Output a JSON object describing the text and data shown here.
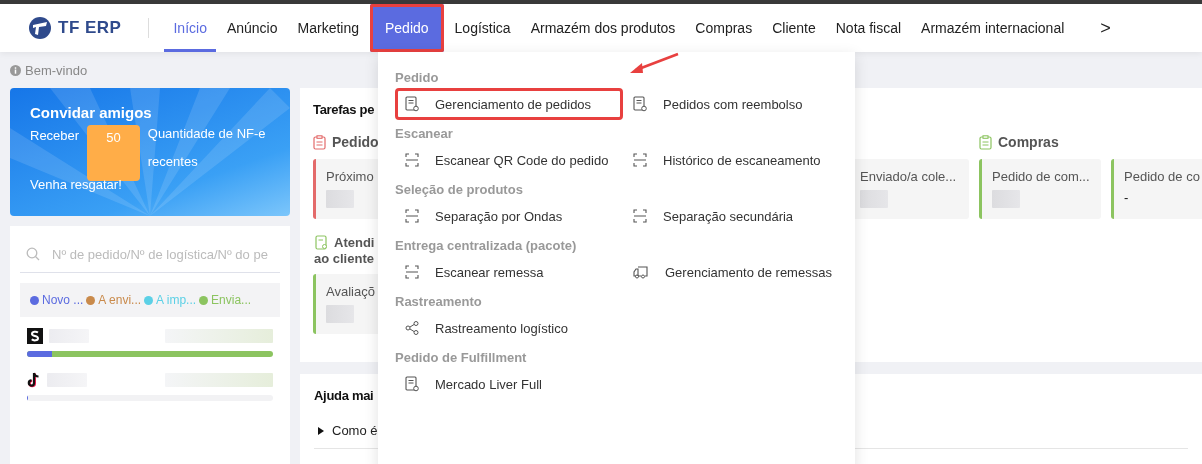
{
  "brand": {
    "name": "TF ERP"
  },
  "nav": [
    {
      "label": "Início",
      "selected": true,
      "open": false,
      "highlighted": false
    },
    {
      "label": "Anúncio",
      "selected": false,
      "open": false,
      "highlighted": false
    },
    {
      "label": "Marketing",
      "selected": false,
      "open": false,
      "highlighted": false
    },
    {
      "label": "Pedido",
      "selected": false,
      "open": true,
      "highlighted": true
    },
    {
      "label": "Logística",
      "selected": false,
      "open": false,
      "highlighted": false
    },
    {
      "label": "Armazém dos produtos",
      "selected": false,
      "open": false,
      "highlighted": false
    },
    {
      "label": "Compras",
      "selected": false,
      "open": false,
      "highlighted": false
    },
    {
      "label": "Cliente",
      "selected": false,
      "open": false,
      "highlighted": false
    },
    {
      "label": "Nota fiscal",
      "selected": false,
      "open": false,
      "highlighted": false
    },
    {
      "label": "Armazém internacional",
      "selected": false,
      "open": false,
      "highlighted": false
    }
  ],
  "nav_more": ">",
  "welcome": "Bem-vindo",
  "invite": {
    "title": "Convidar amigos",
    "prefix": "Receber",
    "amount": "50",
    "suffix": "Quantidade de NF-e recentes",
    "cta": "Venha resgatar!"
  },
  "search": {
    "placeholder": "Nº de pedido/Nº de logística/Nº do pe"
  },
  "statuses": [
    {
      "label": "Novo ...",
      "color": "#5b6be0"
    },
    {
      "label": "A envi...",
      "color": "#c98a4b"
    },
    {
      "label": "A imp...",
      "color": "#5bd0e6"
    },
    {
      "label": "Envia...",
      "color": "#8cc460"
    }
  ],
  "stores": [
    {
      "kind": "shopee",
      "level": 0.1
    },
    {
      "kind": "tiktok",
      "level": 0.005
    }
  ],
  "tasks": {
    "title": "Tarefas pe",
    "sections": [
      {
        "title": "Pedido",
        "kind": "clipboard",
        "color": "#e36a6a",
        "cards": [
          {
            "label": "Próximo"
          },
          {
            "label": "Enviado/a cole..."
          }
        ]
      },
      {
        "title": "Compras",
        "kind": "clipboard",
        "color": "#8cc460",
        "cards": [
          {
            "label": "Pedido de com..."
          },
          {
            "label": "Pedido de co",
            "value": "-"
          }
        ]
      },
      {
        "title": "Atendi",
        "title_line_2": "ao cliente",
        "kind": "service",
        "color": "#8cc460",
        "cards": [
          {
            "label": "Avaliaçõ"
          }
        ]
      }
    ]
  },
  "help": {
    "title": "Ajuda mai",
    "items": [
      "Como é"
    ]
  },
  "menu": [
    {
      "title": "Pedido",
      "items": [
        {
          "label": "Gerenciamento de pedidos",
          "kind": "doc",
          "highlighted": true
        },
        {
          "label": "Pedidos com reembolso",
          "kind": "doc",
          "highlighted": false
        }
      ]
    },
    {
      "title": "Escanear",
      "items": [
        {
          "label": "Escanear QR Code do pedido",
          "kind": "scan",
          "highlighted": false
        },
        {
          "label": "Histórico de escaneamento",
          "kind": "scan",
          "highlighted": false
        }
      ]
    },
    {
      "title": "Seleção de produtos",
      "items": [
        {
          "label": "Separação por Ondas",
          "kind": "scan",
          "highlighted": false
        },
        {
          "label": "Separação secundária",
          "kind": "scan",
          "highlighted": false
        }
      ]
    },
    {
      "title": "Entrega centralizada (pacote)",
      "items": [
        {
          "label": "Escanear remessa",
          "kind": "scan",
          "highlighted": false
        },
        {
          "label": "Gerenciamento de remessas",
          "kind": "truck",
          "highlighted": false
        }
      ]
    },
    {
      "title": "Rastreamento",
      "items": [
        {
          "label": "Rastreamento logístico",
          "kind": "share",
          "highlighted": false
        }
      ]
    },
    {
      "title": "Pedido de Fulfillment",
      "items": [
        {
          "label": "Mercado Liver Full",
          "kind": "doc",
          "highlighted": false
        }
      ]
    }
  ]
}
